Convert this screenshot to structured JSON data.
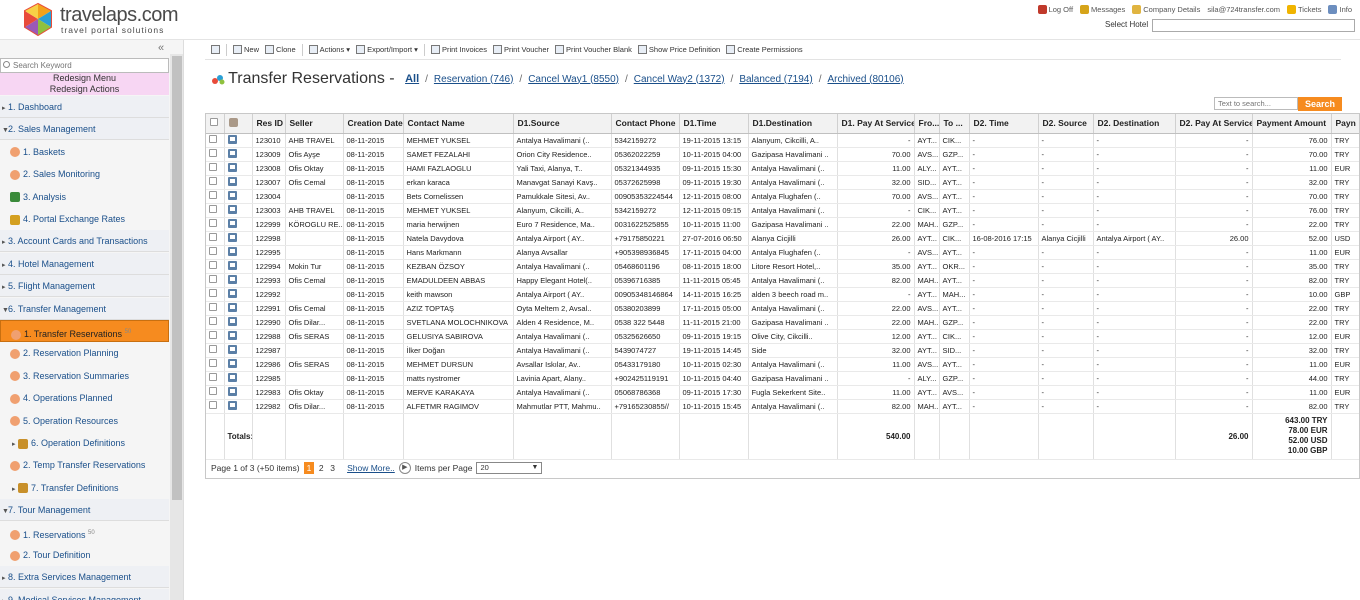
{
  "brand": {
    "name": "travelaps.com",
    "tagline": "travel portal solutions"
  },
  "toplinks": [
    {
      "label": "Log Off",
      "icon": "logoff-icon",
      "color": "#c0392b"
    },
    {
      "label": "Messages",
      "icon": "messages-icon",
      "color": "#d6a419"
    },
    {
      "label": "Company Details",
      "icon": "company-icon",
      "color": "#e0b440"
    },
    {
      "label": "sila@724transfer.com",
      "icon": "",
      "color": ""
    },
    {
      "label": "Tickets",
      "icon": "tickets-icon",
      "color": "#f0b400"
    },
    {
      "label": "Info",
      "icon": "info-icon",
      "color": "#6c8ebf"
    }
  ],
  "select_hotel": {
    "label": "Select Hotel",
    "value": ""
  },
  "sidebar": {
    "collapse": "«",
    "search_placeholder": "Search Keyword",
    "redesign_menu": "Redesign Menu",
    "redesign_actions": "Redesign Actions",
    "items": [
      {
        "label": "1. Dashboard",
        "level": 0,
        "icon": ""
      },
      {
        "label": "2. Sales Management",
        "level": 0,
        "icon": "",
        "expanded": true
      },
      {
        "label": "1. Baskets",
        "level": 1,
        "icon": "gear-icon"
      },
      {
        "label": "2. Sales Monitoring",
        "level": 1,
        "icon": "gear-icon"
      },
      {
        "label": "3. Analysis",
        "level": 1,
        "icon": "tools-icon"
      },
      {
        "label": "4. Portal Exchange Rates",
        "level": 1,
        "icon": "coins-icon"
      },
      {
        "label": "3. Account Cards and Transactions",
        "level": 0,
        "icon": ""
      },
      {
        "label": "4. Hotel Management",
        "level": 0,
        "icon": ""
      },
      {
        "label": "5. Flight Management",
        "level": 0,
        "icon": ""
      },
      {
        "label": "6. Transfer Management",
        "level": 0,
        "icon": "",
        "expanded": true
      },
      {
        "label": "1. Transfer Reservations",
        "level": 1,
        "icon": "gear-icon",
        "badge": "50",
        "active": true
      },
      {
        "label": "2. Reservation Planning",
        "level": 1,
        "icon": "gear-icon"
      },
      {
        "label": "3. Reservation Summaries",
        "level": 1,
        "icon": "gear-icon"
      },
      {
        "label": "4. Operations Planned",
        "level": 1,
        "icon": "gear-icon"
      },
      {
        "label": "5. Operation Resources",
        "level": 1,
        "icon": "gear-icon"
      },
      {
        "label": "6. Operation Definitions",
        "level": 1,
        "icon": "folder-icon",
        "arrow": true
      },
      {
        "label": "2. Temp Transfer Reservations",
        "level": 1,
        "icon": "gear-icon"
      },
      {
        "label": "7. Transfer Definitions",
        "level": 1,
        "icon": "folder-icon",
        "arrow": true
      },
      {
        "label": "7. Tour Management",
        "level": 0,
        "icon": "",
        "expanded": true
      },
      {
        "label": "1. Reservations",
        "level": 1,
        "icon": "gear-icon",
        "badge": "50"
      },
      {
        "label": "2. Tour Definition",
        "level": 1,
        "icon": "gear-icon"
      },
      {
        "label": "8. Extra Services Management",
        "level": 0,
        "icon": ""
      },
      {
        "label": "9. Medical Services Management",
        "level": 0,
        "icon": ""
      }
    ]
  },
  "toolbar": [
    {
      "label": "",
      "icon": "home-icon"
    },
    {
      "label": "New",
      "icon": "new-icon"
    },
    {
      "label": "Clone",
      "icon": "clone-icon"
    },
    {
      "label": "Actions ▾",
      "icon": "actions-icon"
    },
    {
      "label": "Export/Import ▾",
      "icon": "export-icon"
    },
    {
      "label": "Print Invoices",
      "icon": "print-icon"
    },
    {
      "label": "Print Voucher",
      "icon": "print-icon"
    },
    {
      "label": "Print Voucher Blank",
      "icon": "print-icon"
    },
    {
      "label": "Show Price Definition",
      "icon": "price-icon"
    },
    {
      "label": "Create Permissions",
      "icon": "key-icon"
    }
  ],
  "page": {
    "title": "Transfer Reservations - ",
    "tabs": [
      {
        "label": "All",
        "active": true
      },
      {
        "label": "Reservation (746)"
      },
      {
        "label": "Cancel Way1 (8550)"
      },
      {
        "label": "Cancel Way2 (1372)"
      },
      {
        "label": "Balanced (7194)"
      },
      {
        "label": "Archived (80106)"
      }
    ],
    "search_placeholder": "Text to search...",
    "search_button": "Search"
  },
  "table": {
    "columns": [
      "",
      "",
      "Res ID",
      "Seller",
      "Creation Date",
      "Contact Name",
      "D1.Source",
      "Contact Phone",
      "D1.Time",
      "D1.Destination",
      "D1. Pay At Service",
      "Fro...",
      "To ...",
      "D2. Time",
      "D2. Source",
      "D2. Destination",
      "D2. Pay At Service",
      "Payment Amount",
      "Payn"
    ],
    "rows": [
      [
        "123010",
        "AHB TRAVEL",
        "08-11-2015",
        "MEHMET YUKSEL",
        "Antalya Havalimani (..",
        "5342159272",
        "19-11-2015 13:15",
        "Alanyum, Cikcilli, A..",
        "-",
        "AYT...",
        "CIK...",
        "-",
        "-",
        "-",
        "-",
        "76.00",
        "TRY"
      ],
      [
        "123009",
        "Ofis Ayşe",
        "08-11-2015",
        "SAMET FEZALAHI",
        "Orion City Residence..",
        "05362022259",
        "10-11-2015 04:00",
        "Gazipasa Havalimani ..",
        "70.00",
        "AVS...",
        "GZP...",
        "-",
        "-",
        "-",
        "-",
        "70.00",
        "TRY"
      ],
      [
        "123008",
        "Ofis Oktay",
        "08-11-2015",
        "HAMI FAZLAOGLU",
        "Yali Taxi, Alanya, T..",
        "05321344935",
        "09-11-2015 15:30",
        "Antalya Havalimani (..",
        "11.00",
        "ALY...",
        "AYT...",
        "-",
        "-",
        "-",
        "-",
        "11.00",
        "EUR"
      ],
      [
        "123007",
        "Ofis Cemal",
        "08-11-2015",
        "erkan karaca",
        "Manavgat Sanayi Kavş..",
        "05372625998",
        "09-11-2015 19:30",
        "Antalya Havalimani (..",
        "32.00",
        "SID...",
        "AYT...",
        "-",
        "-",
        "-",
        "-",
        "32.00",
        "TRY"
      ],
      [
        "123004",
        "",
        "08-11-2015",
        "Bets Cornelissen",
        "Pamukkale Sitesi, Av..",
        "00905353224544",
        "12-11-2015 08:00",
        "Antalya Flughafen (..",
        "70.00",
        "AVS...",
        "AYT...",
        "-",
        "-",
        "-",
        "-",
        "70.00",
        "TRY"
      ],
      [
        "123003",
        "AHB TRAVEL",
        "08-11-2015",
        "MEHMET YUKSEL",
        "Alanyum, Cikcilli, A..",
        "5342159272",
        "12-11-2015 09:15",
        "Antalya Havalimani (..",
        "-",
        "CIK...",
        "AYT...",
        "-",
        "-",
        "-",
        "-",
        "76.00",
        "TRY"
      ],
      [
        "122999",
        "KÖROGLU RE...",
        "08-11-2015",
        "maria herwijnen",
        "Euro 7 Residence, Ma..",
        "0031622525855",
        "10-11-2015 11:00",
        "Gazipasa Havalimani ..",
        "22.00",
        "MAH...",
        "GZP...",
        "-",
        "-",
        "-",
        "-",
        "22.00",
        "TRY"
      ],
      [
        "122998",
        "",
        "08-11-2015",
        "Natela Davydova",
        "Antalya Airport ( AY..",
        "+79175850221",
        "27-07-2016 06:50",
        "Alanya Cicjilli",
        "26.00",
        "AYT...",
        "CIK...",
        "16-08-2016 17:15",
        "Alanya Cicjilli",
        "Antalya Airport ( AY..",
        "26.00",
        "52.00",
        "USD"
      ],
      [
        "122995",
        "",
        "08-11-2015",
        "Hans Markmann",
        "Alanya Avsallar",
        "+905398936845",
        "17-11-2015 04:00",
        "Antalya Flughafen (..",
        "-",
        "AVS...",
        "AYT...",
        "-",
        "-",
        "-",
        "-",
        "11.00",
        "EUR"
      ],
      [
        "122994",
        "Mokin Tur",
        "08-11-2015",
        "KEZBAN ÖZSOY",
        "Antalya Havalimani (..",
        "05468601196",
        "08-11-2015 18:00",
        "Litore Resort Hotel,..",
        "35.00",
        "AYT...",
        "OKR...",
        "-",
        "-",
        "-",
        "-",
        "35.00",
        "TRY"
      ],
      [
        "122993",
        "Ofis Cemal",
        "08-11-2015",
        "EMADULDEEN ABBAS",
        "Happy Elegant Hotel(..",
        "05396716385",
        "11-11-2015 05:45",
        "Antalya Havalimani (..",
        "82.00",
        "MAH...",
        "AYT...",
        "-",
        "-",
        "-",
        "-",
        "82.00",
        "TRY"
      ],
      [
        "122992",
        "",
        "08-11-2015",
        "keith mawson",
        "Antalya Airport ( AY..",
        "00905348146864",
        "14-11-2015 16:25",
        "alden 3 beech road m..",
        "-",
        "AYT...",
        "MAH...",
        "-",
        "-",
        "-",
        "-",
        "10.00",
        "GBP"
      ],
      [
        "122991",
        "Ofis Cemal",
        "08-11-2015",
        "AZIZ TOPTAŞ",
        "Oyta Meltem 2, Avsal..",
        "05380203899",
        "17-11-2015 05:00",
        "Antalya Havalimani (..",
        "22.00",
        "AVS...",
        "AYT...",
        "-",
        "-",
        "-",
        "-",
        "22.00",
        "TRY"
      ],
      [
        "122990",
        "Ofis Dilar...",
        "08-11-2015",
        "SVETLANA MOLOCHNIKOVA",
        "Alden 4 Residence, M..",
        "0538 322 5448",
        "11-11-2015 21:00",
        "Gazipasa Havalimani ..",
        "22.00",
        "MAH...",
        "GZP...",
        "-",
        "-",
        "-",
        "-",
        "22.00",
        "TRY"
      ],
      [
        "122988",
        "Ofis SERAS",
        "08-11-2015",
        "GELUSIYA SABIROVA",
        "Antalya Havalimani (..",
        "05325626650",
        "09-11-2015 19:15",
        "Olive City, Cikcilli..",
        "12.00",
        "AYT...",
        "CIK...",
        "-",
        "-",
        "-",
        "-",
        "12.00",
        "EUR"
      ],
      [
        "122987",
        "",
        "08-11-2015",
        "İlker Doğan",
        "Antalya Havalimani (..",
        "5439074727",
        "19-11-2015 14:45",
        "Side",
        "32.00",
        "AYT...",
        "SID...",
        "-",
        "-",
        "-",
        "-",
        "32.00",
        "TRY"
      ],
      [
        "122986",
        "Ofis SERAS",
        "08-11-2015",
        "MEHMET DURSUN",
        "Avsallar Iskılar, Av..",
        "05433179180",
        "10-11-2015 02:30",
        "Antalya Havalimani (..",
        "11.00",
        "AVS...",
        "AYT...",
        "-",
        "-",
        "-",
        "-",
        "11.00",
        "EUR"
      ],
      [
        "122985",
        "",
        "08-11-2015",
        "matts nystromer",
        "Lavinia Apart, Alany..",
        "+902425119191",
        "10-11-2015 04:40",
        "Gazipasa Havalimani ..",
        "-",
        "ALY...",
        "GZP...",
        "-",
        "-",
        "-",
        "-",
        "44.00",
        "TRY"
      ],
      [
        "122983",
        "Ofis Oktay",
        "08-11-2015",
        "MERVE KARAKAYA",
        "Antalya Havalimani (..",
        "05068786368",
        "09-11-2015 17:30",
        "Fugla Sekerkent Site..",
        "11.00",
        "AYT...",
        "AVS...",
        "-",
        "-",
        "-",
        "-",
        "11.00",
        "EUR"
      ],
      [
        "122982",
        "Ofis Dilar...",
        "08-11-2015",
        "ALFETMR RAGIMOV",
        "Mahmutlar PTT, Mahmu..",
        "+79165230855//",
        "10-11-2015 15:45",
        "Antalya Havalimani (..",
        "82.00",
        "MAH...",
        "AYT...",
        "-",
        "-",
        "-",
        "-",
        "82.00",
        "TRY"
      ]
    ],
    "totals": {
      "label": "Totals:",
      "d1_pay": "540.00",
      "d2_pay": "26.00",
      "amounts": [
        "643.00 TRY",
        "78.00 EUR",
        "52.00 USD",
        "10.00 GBP"
      ]
    }
  },
  "pager": {
    "info": "Page 1 of 3 (+50 items)",
    "pages": [
      "1",
      "2",
      "3"
    ],
    "current": "1",
    "show_more": "Show More..",
    "ipp_label": "Items per Page",
    "ipp_value": "20"
  }
}
